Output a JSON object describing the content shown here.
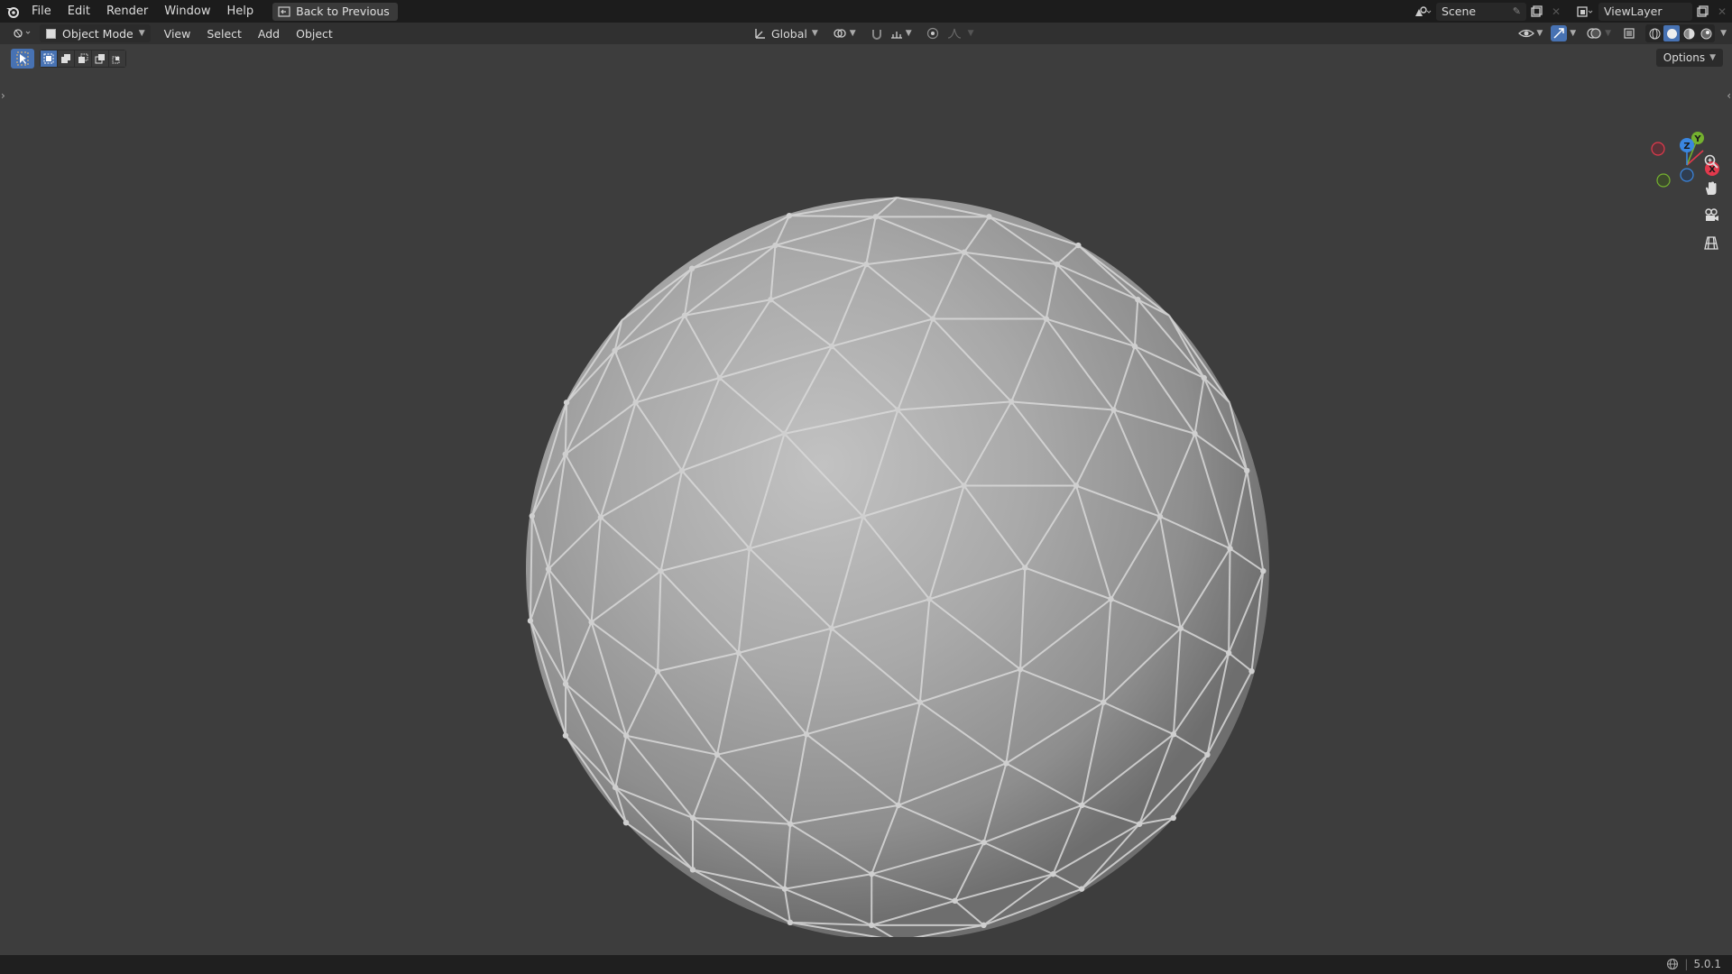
{
  "topbar": {
    "menu": [
      "File",
      "Edit",
      "Render",
      "Window",
      "Help"
    ],
    "back_button": "Back to Previous",
    "scene": "Scene",
    "view_layer": "ViewLayer"
  },
  "header": {
    "mode": "Object Mode",
    "menus": [
      "View",
      "Select",
      "Add",
      "Object"
    ],
    "transform_orientation": "Global"
  },
  "toolbar": {
    "options": "Options"
  },
  "gizmo": {
    "axes": [
      "X",
      "Y",
      "Z"
    ]
  },
  "statusbar": {
    "version": "5.0.1"
  },
  "colors": {
    "x_axis": "#e2394c",
    "y_axis": "#74b12f",
    "z_axis": "#3a86e0",
    "accent": "#4772b3"
  }
}
